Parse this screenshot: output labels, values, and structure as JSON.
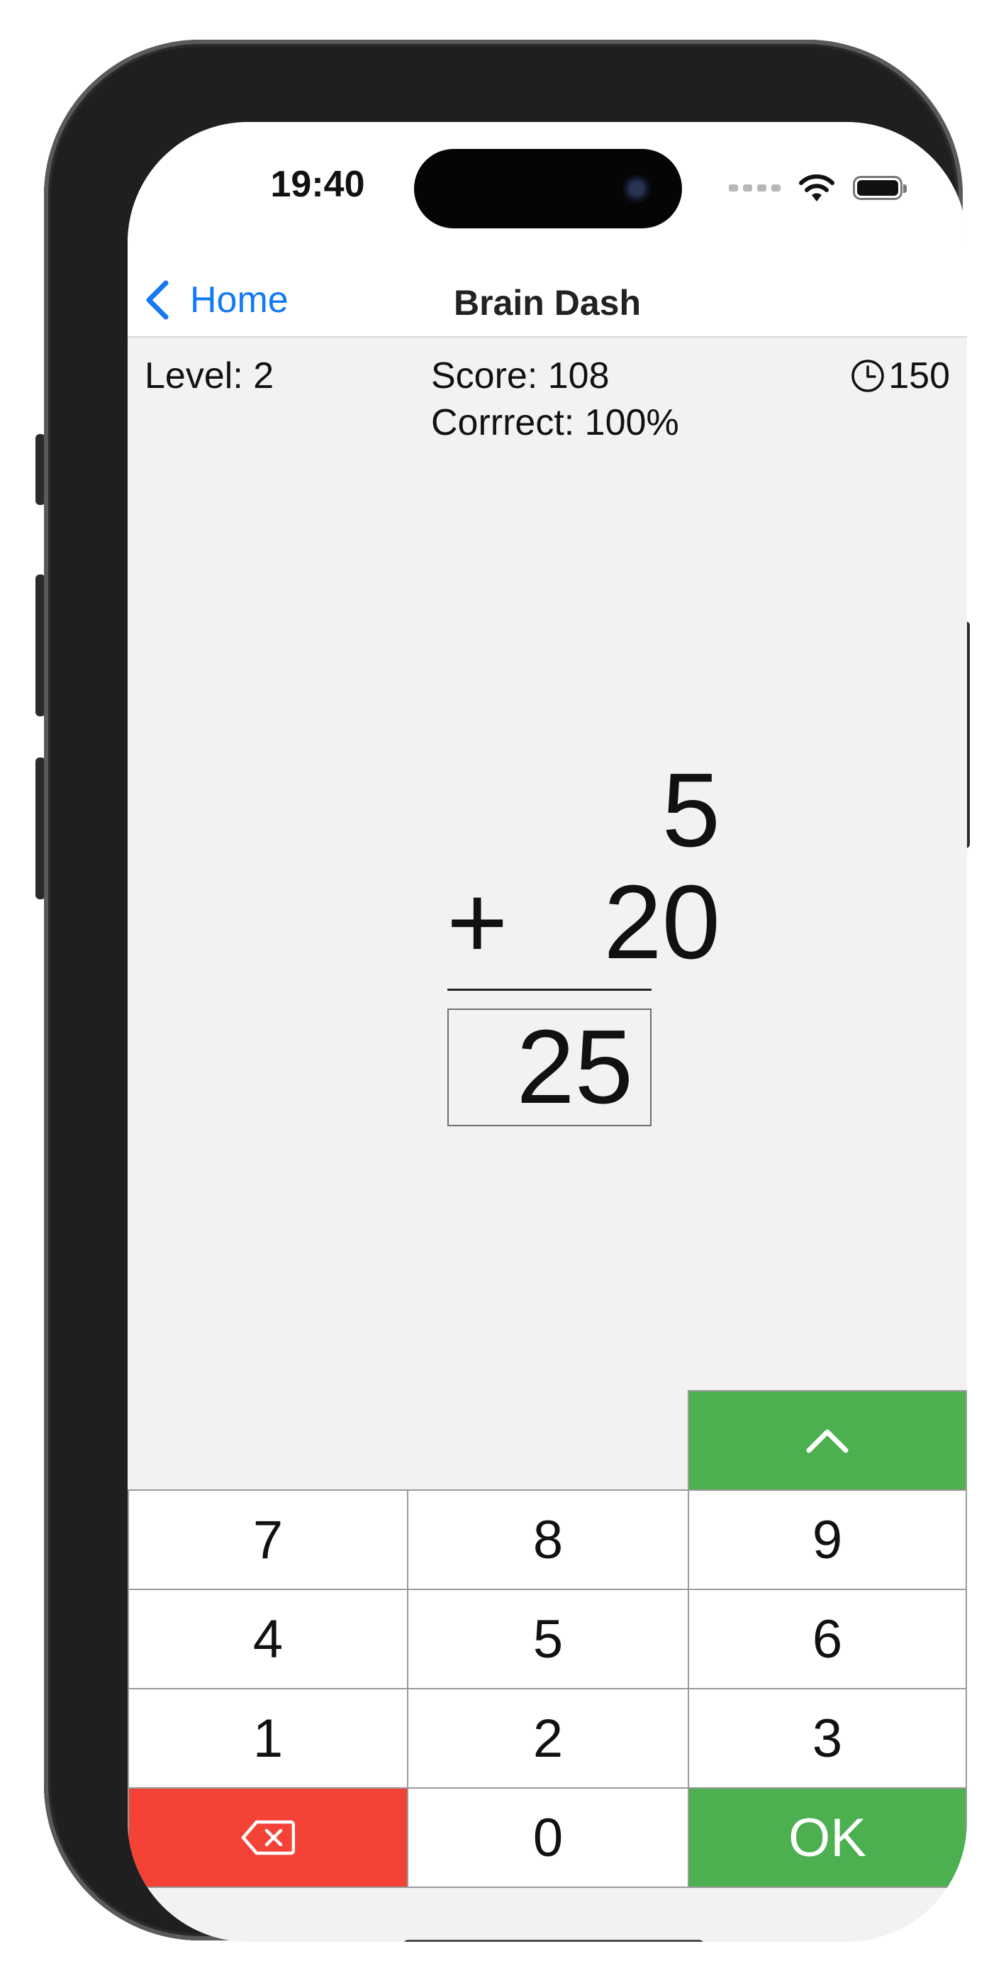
{
  "status_bar": {
    "time": "19:40",
    "icons": [
      "cellular-signal-icon",
      "wifi-icon",
      "battery-icon"
    ]
  },
  "nav": {
    "back_label": "Home",
    "title": "Brain Dash"
  },
  "game": {
    "level": "Level: 2",
    "score": "Score: 108",
    "correct": "Corrrect: 100%",
    "timer": "150"
  },
  "problem": {
    "operand_top": "5",
    "operator": "+",
    "operand_bottom": "20",
    "answer": "25"
  },
  "keypad": {
    "key_7": "7",
    "key_8": "8",
    "key_9": "9",
    "key_4": "4",
    "key_5": "5",
    "key_6": "6",
    "key_1": "1",
    "key_2": "2",
    "key_3": "3",
    "key_0": "0",
    "ok_label": "OK",
    "icons": [
      "chevron-up-icon",
      "backspace-icon"
    ]
  },
  "colors": {
    "accent_blue": "#1479f2",
    "key_green": "#4caf50",
    "key_red": "#f44336",
    "background": "#f2f2f2"
  }
}
